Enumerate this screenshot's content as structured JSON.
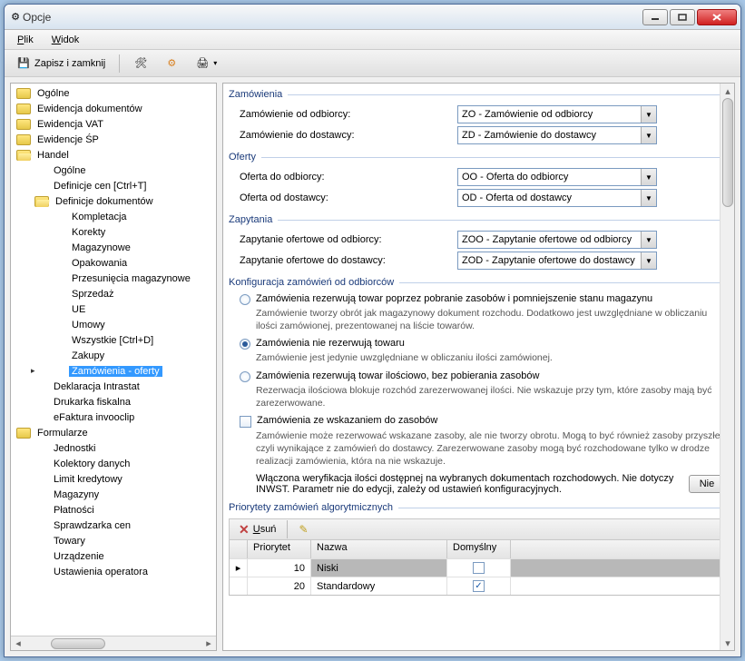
{
  "window": {
    "title": "Opcje"
  },
  "menu": {
    "plik": "Plik",
    "widok": "Widok"
  },
  "toolbar": {
    "save_close": "Zapisz i zamknij"
  },
  "tree": {
    "items": [
      {
        "label": "Ogólne",
        "depth": 0,
        "folder": true
      },
      {
        "label": "Ewidencja dokumentów",
        "depth": 0,
        "folder": true
      },
      {
        "label": "Ewidencja VAT",
        "depth": 0,
        "folder": true
      },
      {
        "label": "Ewidencje ŚP",
        "depth": 0,
        "folder": true
      },
      {
        "label": "Handel",
        "depth": 0,
        "folder": true,
        "open": true
      },
      {
        "label": "Ogólne",
        "depth": 1
      },
      {
        "label": "Definicje cen [Ctrl+T]",
        "depth": 1
      },
      {
        "label": "Definicje dokumentów",
        "depth": 1,
        "folder": true,
        "open": true
      },
      {
        "label": "Kompletacja",
        "depth": 2
      },
      {
        "label": "Korekty",
        "depth": 2
      },
      {
        "label": "Magazynowe",
        "depth": 2
      },
      {
        "label": "Opakowania",
        "depth": 2
      },
      {
        "label": "Przesunięcia magazynowe",
        "depth": 2
      },
      {
        "label": "Sprzedaż",
        "depth": 2
      },
      {
        "label": "UE",
        "depth": 2
      },
      {
        "label": "Umowy",
        "depth": 2
      },
      {
        "label": "Wszystkie [Ctrl+D]",
        "depth": 2
      },
      {
        "label": "Zakupy",
        "depth": 2
      },
      {
        "label": "Zamówienia - oferty",
        "depth": 2,
        "selected": true
      },
      {
        "label": "Deklaracja Intrastat",
        "depth": 1
      },
      {
        "label": "Drukarka fiskalna",
        "depth": 1
      },
      {
        "label": "eFaktura invooclip",
        "depth": 1
      },
      {
        "label": "Formularze",
        "depth": 0,
        "folder": true
      },
      {
        "label": "Jednostki",
        "depth": 1
      },
      {
        "label": "Kolektory danych",
        "depth": 1
      },
      {
        "label": "Limit kredytowy",
        "depth": 1
      },
      {
        "label": "Magazyny",
        "depth": 1
      },
      {
        "label": "Płatności",
        "depth": 1
      },
      {
        "label": "Sprawdzarka cen",
        "depth": 1
      },
      {
        "label": "Towary",
        "depth": 1
      },
      {
        "label": "Urządzenie",
        "depth": 1
      },
      {
        "label": "Ustawienia operatora",
        "depth": 1
      }
    ]
  },
  "groups": {
    "zamowienia": {
      "title": "Zamówienia",
      "fields": {
        "od_odbiorcy_lbl": "Zamówienie od odbiorcy:",
        "od_odbiorcy_val": "ZO - Zamówienie od odbiorcy",
        "do_dostawcy_lbl": "Zamówienie do dostawcy:",
        "do_dostawcy_val": "ZD - Zamówienie do dostawcy"
      }
    },
    "oferty": {
      "title": "Oferty",
      "fields": {
        "do_odbiorcy_lbl": "Oferta do odbiorcy:",
        "do_odbiorcy_val": "OO - Oferta do odbiorcy",
        "od_dostawcy_lbl": "Oferta od dostawcy:",
        "od_dostawcy_val": "OD - Oferta od dostawcy"
      }
    },
    "zapytania": {
      "title": "Zapytania",
      "fields": {
        "od_odbiorcy_lbl": "Zapytanie ofertowe od odbiorcy:",
        "od_odbiorcy_val": "ZOO - Zapytanie ofertowe od odbiorcy",
        "do_dostawcy_lbl": "Zapytanie ofertowe do dostawcy:",
        "do_dostawcy_val": "ZOD - Zapytanie ofertowe do dostawcy"
      }
    },
    "konfig": {
      "title": "Konfiguracja zamówień od odbiorców",
      "opt1": "Zamówienia rezerwują towar poprzez pobranie zasobów i pomniejszenie stanu magazynu",
      "opt1_desc": "Zamówienie tworzy obrót jak magazynowy dokument rozchodu. Dodatkowo jest uwzględniane w obliczaniu ilości zamówionej, prezentowanej na liście towarów.",
      "opt2": "Zamówienia nie rezerwują towaru",
      "opt2_desc": "Zamówienie jest jedynie uwzględniane w obliczaniu ilości zamówionej.",
      "opt3": "Zamówienia rezerwują towar ilościowo, bez pobierania zasobów",
      "opt3_desc": "Rezerwacja ilościowa blokuje rozchód zarezerwowanej ilości. Nie wskazuje przy tym, które zasoby mają być zarezerwowane.",
      "chk1": "Zamówienia ze wskazaniem do zasobów",
      "chk1_desc": "Zamówienie może rezerwować wskazane zasoby, ale nie tworzy obrotu. Mogą to być również zasoby przyszłe, czyli wynikające z zamówień do dostawcy. Zarezerwowane zasoby mogą być rozchodowane tylko w drodze realizacji zamówienia, która na nie wskazuje.",
      "footer": "Włączona weryfikacja ilości dostępnej na wybranych dokumentach rozchodowych. Nie dotyczy INWST. Parametr nie do edycji, zależy od ustawień konfiguracyjnych.",
      "toggle": "Nie"
    },
    "priorytety": {
      "title": "Priorytety zamówień algorytmicznych",
      "del_btn": "Usuń",
      "cols": {
        "pri": "Priorytet",
        "name": "Nazwa",
        "def": "Domyślny"
      },
      "rows": [
        {
          "pri": "10",
          "name": "Niski",
          "def": false,
          "sel": true
        },
        {
          "pri": "20",
          "name": "Standardowy",
          "def": true,
          "sel": false
        }
      ]
    }
  }
}
